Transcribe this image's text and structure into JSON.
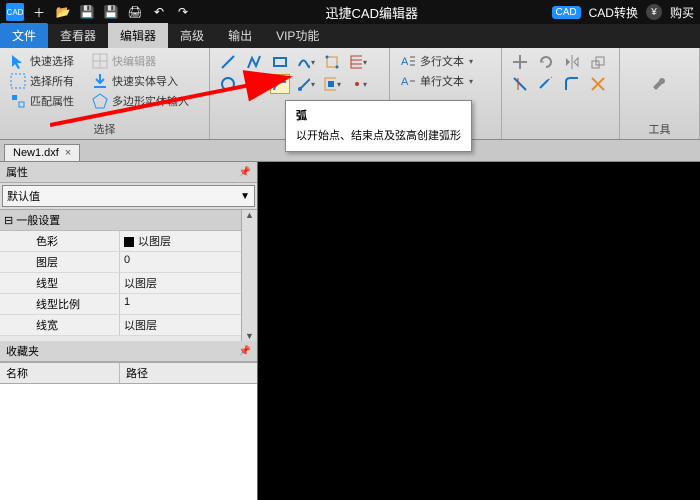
{
  "titlebar": {
    "title": "迅捷CAD编辑器",
    "convert": "CAD转换",
    "buy": "购买"
  },
  "menus": {
    "file": "文件",
    "viewer": "查看器",
    "editor": "编辑器",
    "advanced": "高级",
    "output": "输出",
    "vip": "VIP功能"
  },
  "ribbon": {
    "g1": {
      "quick_select": "快速选择",
      "quick_editor": "快编辑器",
      "select_all": "选择所有",
      "quick_solid_import": "快速实体导入",
      "match_props": "匹配属性",
      "polygon_solid_input": "多边形实体输入",
      "select_label": "选择"
    },
    "g3": {
      "mtext": "多行文本",
      "stext": "单行文本"
    },
    "g5": {
      "tools": "工具"
    }
  },
  "tooltip": {
    "title": "弧",
    "body": "以开始点、结束点及弦高创建弧形"
  },
  "doc": {
    "name": "New1.dxf"
  },
  "panel": {
    "props_title": "属性",
    "default_combo": "默认值",
    "section": "一般设置",
    "rows": {
      "color_k": "色彩",
      "color_v": "以图层",
      "layer_k": "图层",
      "layer_v": "0",
      "ltype_k": "线型",
      "ltype_v": "以图层",
      "lscale_k": "线型比例",
      "lscale_v": "1",
      "lweight_k": "线宽",
      "lweight_v": "以图层"
    },
    "fav_title": "收藏夹",
    "col_name": "名称",
    "col_path": "路径"
  }
}
